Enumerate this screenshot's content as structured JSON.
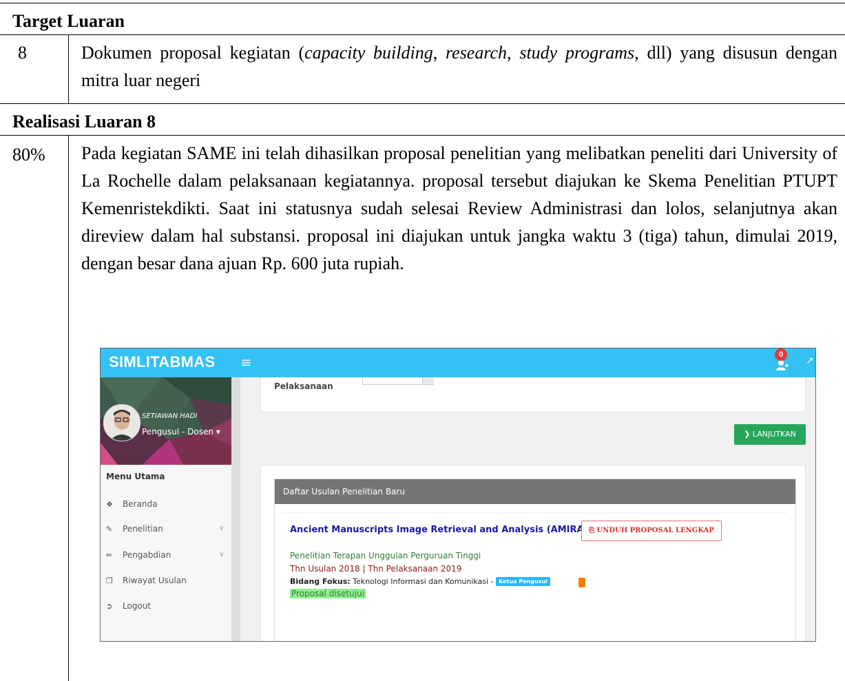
{
  "table": {
    "target_heading": "Target Luaran",
    "target_no": "8",
    "target_text_1": "Dokumen proposal kegiatan (",
    "target_italic_1": "capacity building",
    "target_text_2": ", ",
    "target_italic_2": "research",
    "target_text_3": ", ",
    "target_italic_3": "study programs",
    "target_text_4": ", dll) yang disusun dengan mitra luar negeri",
    "realisasi_heading": "Realisasi Luaran 8",
    "realisasi_percent": "80%",
    "realisasi_text": "Pada kegiatan SAME ini telah dihasilkan proposal penelitian yang melibatkan peneliti dari University of La Rochelle dalam pelaksanaan kegiatannya. proposal tersebut diajukan ke Skema Penelitian PTUPT Kemenristekdikti. Saat ini statusnya sudah selesai Review Administrasi dan lolos, selanjutnya akan direview dalam hal substansi. proposal ini diajukan untuk jangka waktu 3 (tiga) tahun, dimulai 2019, dengan besar dana ajuan Rp. 600 juta rupiah."
  },
  "screenshot": {
    "brand": "SIMLITABMAS",
    "notif_count": "0",
    "user_name": "SETIAWAN HADI",
    "user_role": "Pengusul - Dosen",
    "menu_heading": "Menu Utama",
    "menu": [
      {
        "label": "Beranda",
        "icon": "home-icon"
      },
      {
        "label": "Penelitian",
        "icon": "edit-icon"
      },
      {
        "label": "Pengabdian",
        "icon": "pencil-icon"
      },
      {
        "label": "Riwayat Usulan",
        "icon": "copy-icon"
      },
      {
        "label": "Logout",
        "icon": "logout-icon"
      }
    ],
    "field_label": "Pelaksanaan",
    "continue_button": "LANJUTKAN",
    "panel_title": "Daftar Usulan Penelitian Baru",
    "proposal_title": "Ancient Manuscripts Image Retrieval and Analysis (AMIRA)",
    "download_button": "UNDUH PROPOSAL LENGKAP",
    "skema": "Penelitian Terapan Unggulan Perguruan Tinggi",
    "years": "Thn Usulan 2018 | Thn Pelaksanaan 2019",
    "bidang_label": "Bidang Fokus:",
    "bidang_value": "Teknologi Informasi dan Komunikasi -",
    "role_badge": "Ketua Pengusul",
    "status": "Proposal disetujui",
    "colors": {
      "topbar": "#34c1f4",
      "continue": "#26a65b",
      "panel_head": "#757575",
      "title": "#1a1aa6"
    }
  }
}
